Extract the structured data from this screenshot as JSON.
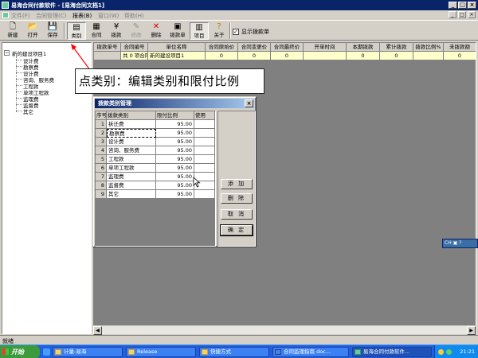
{
  "window": {
    "title": "易海合同付款软件 - [易海合同文档1]",
    "controls": [
      "_",
      "□",
      "×"
    ]
  },
  "menu": {
    "items": [
      {
        "label": "文件(F)",
        "enabled": false
      },
      {
        "label": "合同管理(C)",
        "enabled": false
      },
      {
        "label": "报表(B)",
        "enabled": true
      },
      {
        "label": "窗口(W)",
        "enabled": false
      },
      {
        "label": "帮助(H)",
        "enabled": false
      }
    ],
    "mdi_controls": [
      "_",
      "□",
      "×"
    ]
  },
  "toolbar": {
    "buttons": [
      {
        "label": "新建",
        "icon": "new-file-icon",
        "glyph": "🗋",
        "enabled": true
      },
      {
        "label": "打开",
        "icon": "open-folder-icon",
        "glyph": "📂",
        "enabled": true
      },
      {
        "label": "保存",
        "icon": "save-disk-icon",
        "glyph": "💾",
        "enabled": true
      },
      {
        "label": "类别",
        "icon": "category-icon",
        "glyph": "▤",
        "enabled": true
      },
      {
        "label": "合同",
        "icon": "contract-icon",
        "glyph": "▦",
        "enabled": true
      },
      {
        "label": "拨款",
        "icon": "money-icon",
        "glyph": "¥",
        "enabled": true
      },
      {
        "label": "修改",
        "icon": "edit-icon",
        "glyph": "✎",
        "enabled": false
      },
      {
        "label": "删除",
        "icon": "delete-x-icon",
        "glyph": "✕",
        "enabled": true
      },
      {
        "label": "拨款单",
        "icon": "printer-icon",
        "glyph": "▣",
        "enabled": true
      },
      {
        "label": "项目",
        "icon": "project-icon",
        "glyph": "▥",
        "enabled": true
      },
      {
        "label": "关于",
        "icon": "help-icon",
        "glyph": "?",
        "enabled": true
      }
    ],
    "show_payment_checkbox": {
      "label": "显示拨款单",
      "checked": true
    }
  },
  "tree": {
    "root": "新的建设项目1",
    "children": [
      "设计费",
      "勘察费",
      "设计费",
      "咨询、服务费",
      "工程款",
      "单项工程款",
      "监理费",
      "监督费",
      "其它"
    ]
  },
  "main_grid": {
    "columns": [
      "拨款单号",
      "合同编号",
      "单位名称",
      "合同原始价",
      "合同变更价",
      "合同最终价",
      "开单时间",
      "本期拨款",
      "累计拨款",
      "拨款比例%",
      "未拨款额"
    ],
    "row": [
      "",
      "共 0 项合同",
      "新的建设项目1",
      "0",
      "0",
      "0",
      "",
      "0",
      "0",
      "",
      "0"
    ]
  },
  "callout": {
    "text": "点类别：编辑类别和限付比例"
  },
  "dialog": {
    "title": "拨款类别管理",
    "columns": [
      "序号",
      "拨款类别",
      "限付比例",
      "使用"
    ],
    "rows": [
      {
        "no": "1",
        "name": "拆迁费",
        "ratio": "95.00",
        "use": ""
      },
      {
        "no": "2",
        "name": "勘察费",
        "ratio": "95.00",
        "use": ""
      },
      {
        "no": "3",
        "name": "设计费",
        "ratio": "95.00",
        "use": ""
      },
      {
        "no": "4",
        "name": "咨询、服务费",
        "ratio": "95.00",
        "use": ""
      },
      {
        "no": "5",
        "name": "工程款",
        "ratio": "95.00",
        "use": ""
      },
      {
        "no": "6",
        "name": "单项工程款",
        "ratio": "95.00",
        "use": ""
      },
      {
        "no": "7",
        "name": "监理费",
        "ratio": "95.00",
        "use": ""
      },
      {
        "no": "8",
        "name": "监督费",
        "ratio": "95.00",
        "use": ""
      },
      {
        "no": "9",
        "name": "其它",
        "ratio": "95.00",
        "use": ""
      }
    ],
    "buttons": {
      "add": "添 加",
      "delete": "删 除",
      "cancel": "取 消",
      "ok": "确 定"
    }
  },
  "statusbar": {
    "text": "就绪"
  },
  "floating_toolbar": {
    "text": "CH ▣ ?"
  },
  "taskbar": {
    "start_label": "开始",
    "tasks": [
      "计量-易海",
      "Release",
      "快捷方式",
      "合同监理指南 doc...",
      "易海合同付款软件..."
    ],
    "active_task_index": 4,
    "clock": "21:21"
  },
  "colors": {
    "titlebar": "#0a246a",
    "grid_row": "#ffffcc",
    "taskbar": "#245edb",
    "start": "#3c9c3c",
    "annotation_arrow": "#ff0000"
  }
}
